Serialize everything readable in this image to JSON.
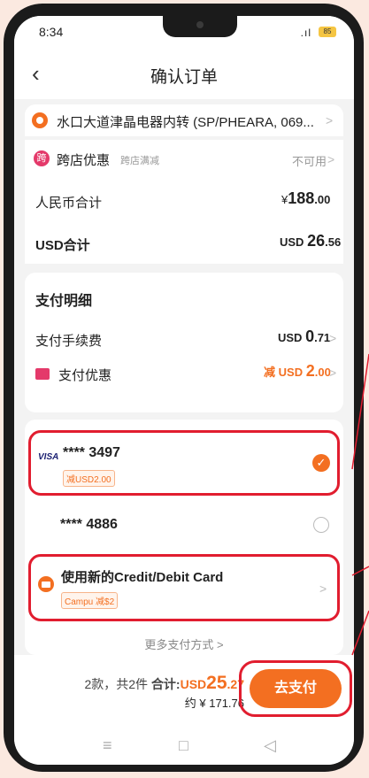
{
  "status": {
    "time": "8:34",
    "signal": ".ıl",
    "battery": "85"
  },
  "nav": {
    "back_icon": "‹",
    "title": "确认订单"
  },
  "address": {
    "text": "水口大道津晶电器内转 (SP/PHEARA, 069...",
    "chevron": ">"
  },
  "summary": {
    "cross_store": {
      "badge": "跨",
      "label": "跨店优惠",
      "sub": "跨店满减",
      "value": "不可用",
      "chevron": ">"
    },
    "rmb": {
      "label": "人民币合计",
      "symbol": "¥",
      "int": "188",
      "dec": ".00"
    },
    "usd": {
      "label": "USD合计",
      "currency": "USD",
      "int": "26",
      "dec": ".56"
    }
  },
  "payment_detail": {
    "title": "支付明细",
    "fee": {
      "label": "支付手续费",
      "currency": "USD",
      "int": "0",
      "dec": ".71",
      "chevron": ">"
    },
    "discount": {
      "label": "支付优惠",
      "prefix": "减",
      "currency": "USD",
      "int": "2",
      "dec": ".00",
      "chevron": ">"
    }
  },
  "cards": [
    {
      "brand": "VISA",
      "number": "**** 3497",
      "promo": "减USD2.00",
      "selected": true
    },
    {
      "brand": "",
      "number": "**** 4886",
      "promo": "",
      "selected": false
    }
  ],
  "new_card": {
    "label": "使用新的Credit/Debit Card",
    "promo": "Campu 减$2",
    "chevron": ">"
  },
  "more_methods": "更多支付方式 >",
  "footer": {
    "count": "2款，共2件",
    "total_label": "合计:",
    "total_currency": "USD",
    "total_int": "25",
    "total_dec": ".27",
    "approx": "约 ¥ 171.76",
    "pay_button": "去支付"
  },
  "sysnav": {
    "menu": "≡",
    "home": "□",
    "back": "◁"
  },
  "colors": {
    "accent": "#f36f21",
    "highlight": "#e11d2f",
    "pink": "#e4396a"
  }
}
